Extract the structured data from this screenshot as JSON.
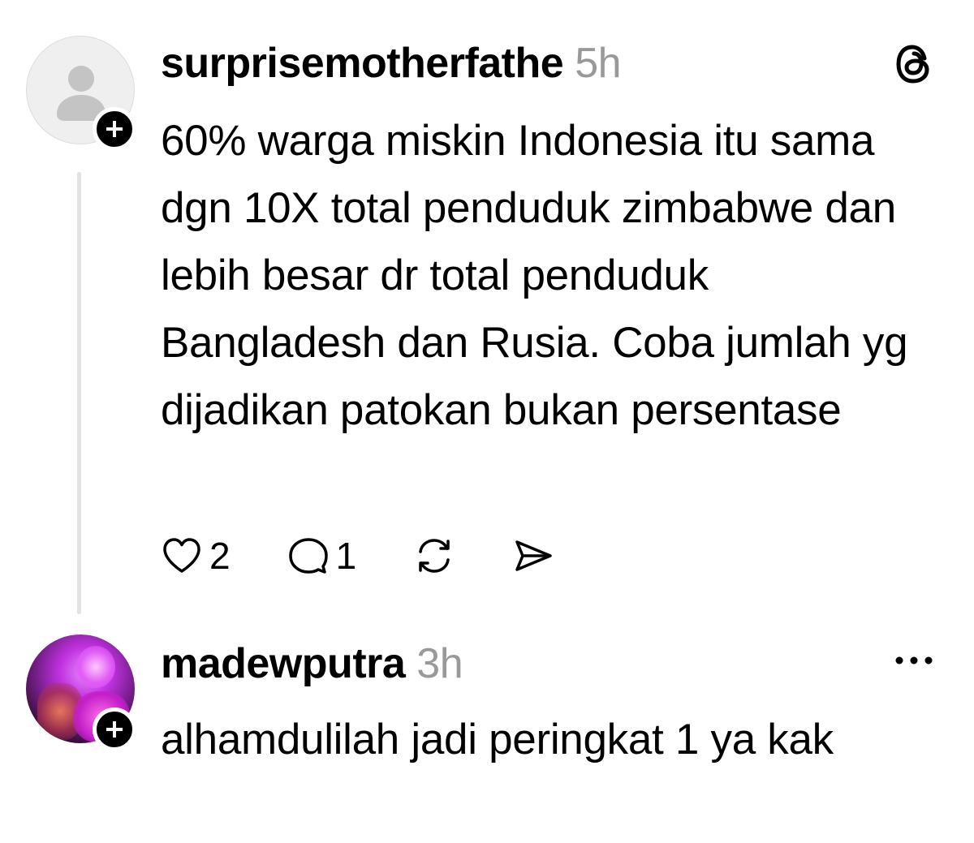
{
  "posts": [
    {
      "username": "surprisemotherfathe",
      "time": "5h",
      "text": "60% warga miskin Indonesia itu sama dgn 10X total penduduk zimbabwe dan lebih besar dr total penduduk Bangladesh dan Rusia. Coba jumlah yg dijadikan patokan bukan persentase",
      "likes": "2",
      "replies": "1",
      "corner_icon": "threads-logo-icon",
      "avatar": "default-avatar"
    },
    {
      "username": "madewputra",
      "time": "3h",
      "text": "alhamdulilah jadi peringkat 1 ya kak",
      "corner_icon": "more-options-icon",
      "avatar": "photo-avatar"
    }
  ],
  "colors": {
    "text": "#000000",
    "muted": "#999999",
    "thread_line": "#e2e2e2",
    "badge": "#000000"
  }
}
